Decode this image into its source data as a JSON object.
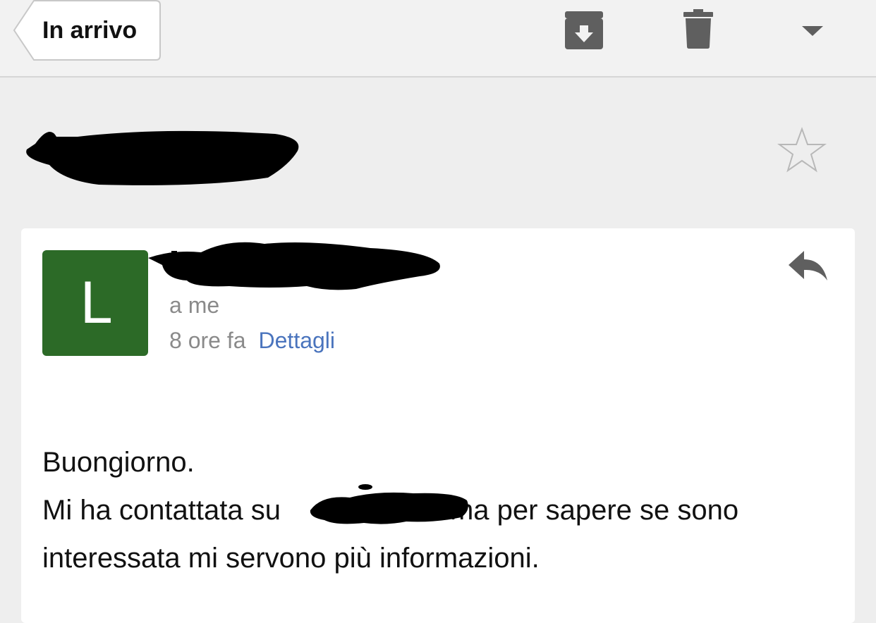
{
  "toolbar": {
    "back_label": "In arrivo",
    "icons": [
      "archive-icon",
      "trash-icon",
      "chevron-down-icon"
    ]
  },
  "message": {
    "avatar_letter": "L",
    "avatar_color": "#2c6a27",
    "recipient": "a me",
    "time": "8 ore fa",
    "details_link": "Dettagli",
    "body": {
      "line1": "Buongiorno.",
      "line2_start": "Mi ha contattata su",
      "line2_end": "ma per sapere se sono",
      "line3": "interessata mi servono più informazioni."
    }
  },
  "colors": {
    "link": "#4a74bd",
    "background": "#eeeeee",
    "card": "#ffffff"
  }
}
